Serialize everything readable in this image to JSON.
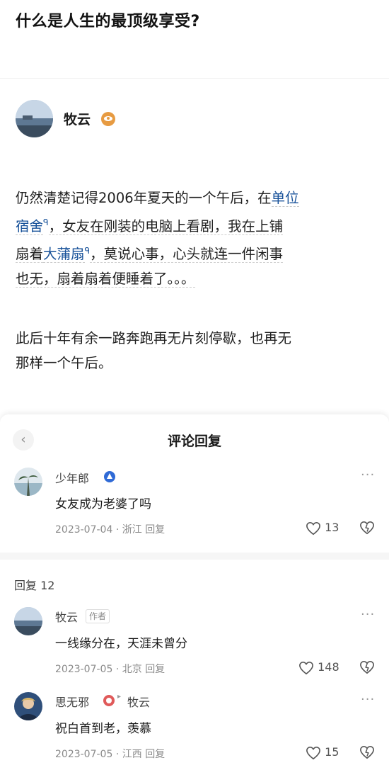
{
  "question": {
    "title": "什么是人生的最顶级享受?"
  },
  "answer": {
    "author_name": "牧云",
    "para1_a": "仍然清楚记得2006年夏天的一个午后，在",
    "link1": "单位",
    "para1_b_link": "宿舍",
    "para1_c": "，女友在刚装的电脑上看剧，我在上铺",
    "para1_d": "扇着",
    "link2": "大蒲扇",
    "para1_e": "，莫说心事，心头就连一件闲事",
    "para1_f": "也无，扇着扇着便睡着了。。。",
    "para2_line1": "此后十年有余一路奔跑再无片刻停歇，也再无",
    "para2_line2": "那样一个午后。"
  },
  "sheet": {
    "title": "评论回复",
    "back_icon": "‹"
  },
  "main_comment": {
    "name": "少年郎",
    "text": "女友成为老婆了吗",
    "date": "2023-07-04",
    "location": "浙江",
    "reply_label": "回复",
    "likes": "13",
    "more": "···"
  },
  "replies_header": "回复 12",
  "replies": [
    {
      "name": "牧云",
      "tag": "作者",
      "text": "一线缘分在，天涯未曾分",
      "date": "2023-07-05",
      "location": "北京",
      "reply_label": "回复",
      "likes": "148",
      "more": "···"
    },
    {
      "name": "思无邪",
      "reply_to": "牧云",
      "text": "祝白首到老，羡慕",
      "date": "2023-07-05",
      "location": "江西",
      "reply_label": "回复",
      "likes": "15",
      "more": "···"
    }
  ],
  "sep_dot": "·",
  "arrow": "▸",
  "mag_glyph": "ᑫ",
  "colors": {
    "link": "#175199",
    "badge_orange": "#e79b42",
    "badge_blue": "#2f6ad6",
    "badge_red": "#e05a5a"
  }
}
